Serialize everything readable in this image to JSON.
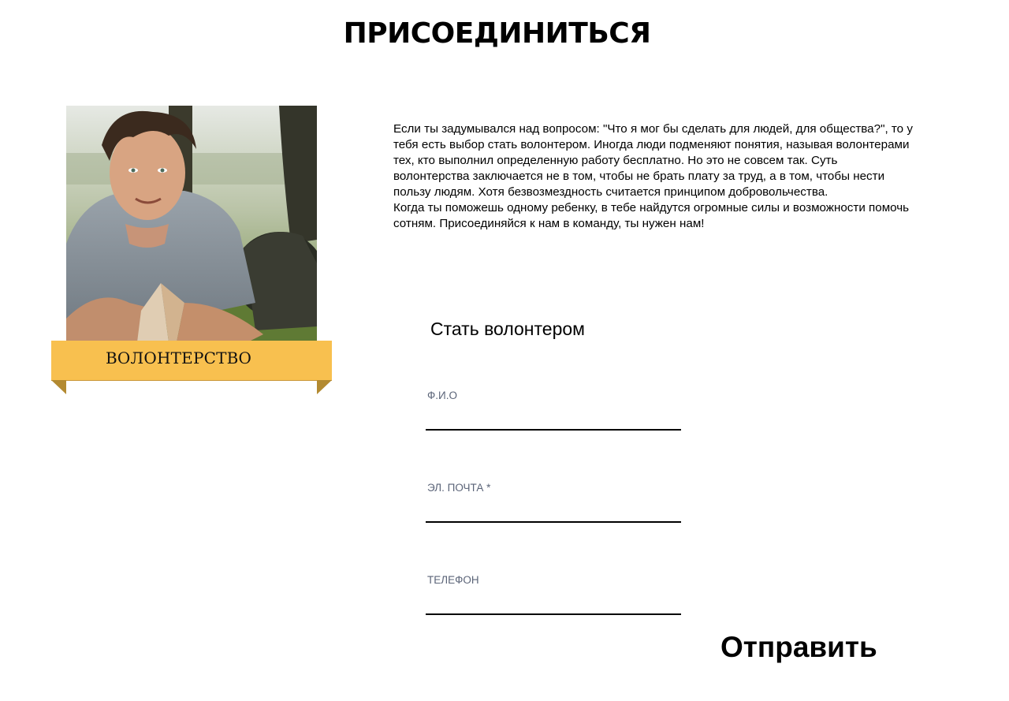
{
  "header": {
    "title": "ПРИСОЕДИНИТЬСЯ"
  },
  "card": {
    "image": "volunteer-photo",
    "ribbon_label": "ВОЛОНТЕРСТВО",
    "ribbon_color": "#f8c04f",
    "ribbon_fold_color": "#b38a31"
  },
  "intro": {
    "paragraphs": [
      "Если ты задумывался над вопросом: \"Что я мог бы сделать для людей, для общества?\", то у тебя есть выбор стать волонтером. Иногда люди подменяют понятия, называя волонтерами тех, кто выполнил определенную работу бесплатно. Но это не совсем так. Суть волонтерства заключается не в том, чтобы не брать плату за труд, а в том, чтобы нести пользу людям. Хотя безвозмездность считается принципом добровольчества.",
      "Когда ты поможешь одному ребенку, в тебе найдутся огромные силы и возможности помочь сотням. Присоединяйся к нам в команду, ты нужен нам!"
    ]
  },
  "form": {
    "title": "Стать волонтером",
    "fields": [
      {
        "label": "Ф.И.О",
        "value": ""
      },
      {
        "label": "ЭЛ. ПОЧТА *",
        "value": ""
      },
      {
        "label": "ТЕЛЕФОН",
        "value": ""
      }
    ],
    "submit_label": "Отправить",
    "label_color": "#5b6478"
  }
}
